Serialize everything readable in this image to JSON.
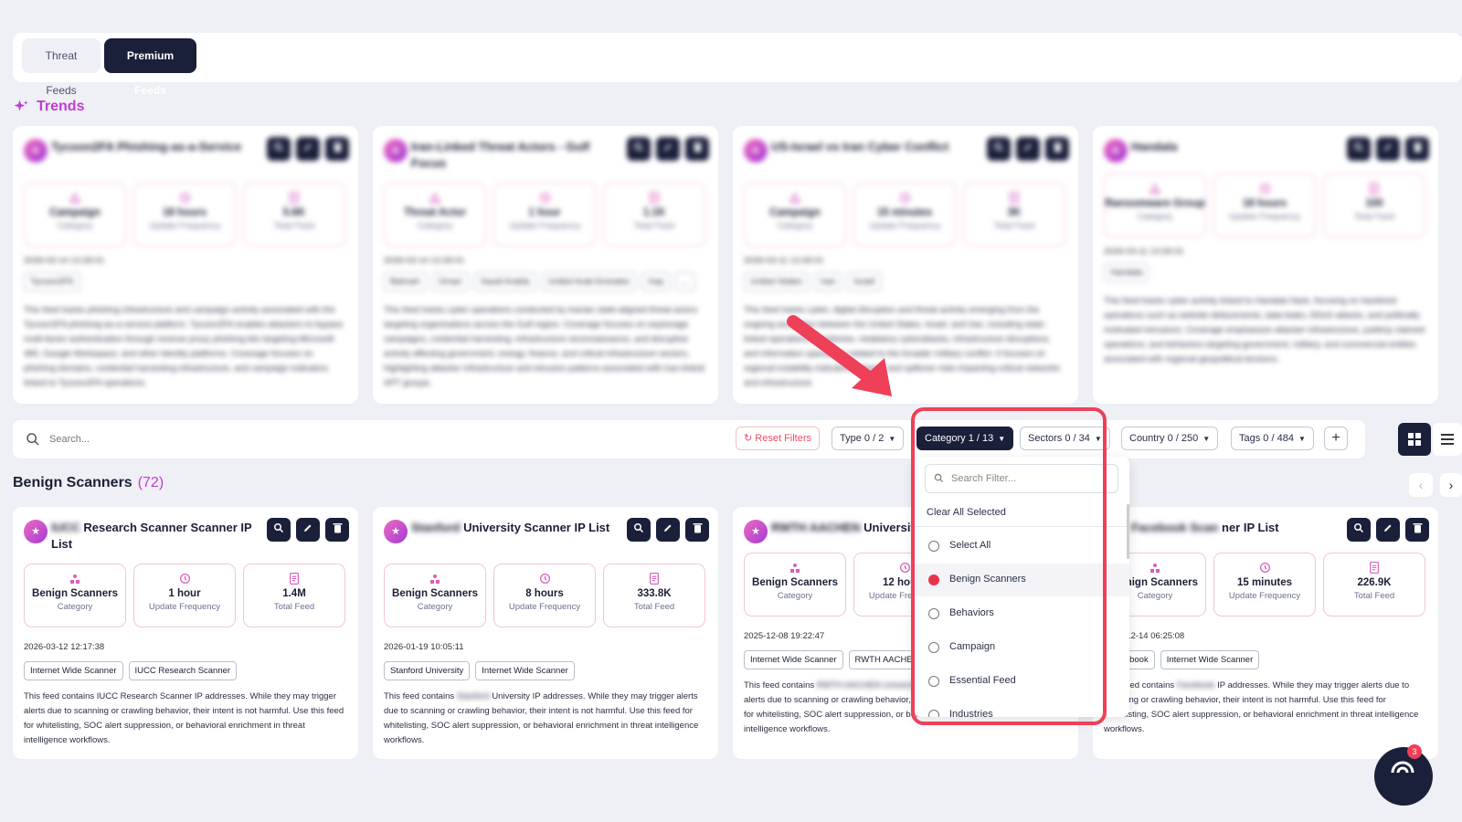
{
  "tabs": [
    {
      "label": "Threat Feeds"
    },
    {
      "label": "Premium Feeds"
    }
  ],
  "trends": {
    "title": "Trends"
  },
  "trend_cards": [
    {
      "title": "Tycoon2FA Phishing-as-a-Service",
      "stats": [
        {
          "v": "Campaign",
          "l": "Category"
        },
        {
          "v": "18 hours",
          "l": "Update Frequency"
        },
        {
          "v": "5.6K",
          "l": "Total Feed"
        }
      ],
      "date": "2026-03-14 13:26:01",
      "tags": [
        "Tycoon2FA"
      ],
      "desc": "This feed tracks phishing infrastructure and campaign activity associated with the Tycoon2FA phishing-as-a-service platform. Tycoon2FA enables attackers to bypass multi-factor authentication through reverse proxy phishing kits targeting Microsoft 365, Google Workspace, and other identity platforms. Coverage focuses on phishing domains, credential harvesting infrastructure, and campaign indicators linked to Tycoon2FA operations."
    },
    {
      "title": "Iran-Linked Threat Actors - Gulf Focus",
      "stats": [
        {
          "v": "Threat Actor",
          "l": "Category"
        },
        {
          "v": "1 hour",
          "l": "Update Frequency"
        },
        {
          "v": "1.1K",
          "l": "Total Feed"
        }
      ],
      "date": "2026-03-14 13:26:01",
      "tags": [
        "Bahrain",
        "Oman",
        "Saudi Arabia",
        "United Arab Emirates",
        "Iraq",
        "..."
      ],
      "desc": "This feed tracks cyber operations conducted by Iranian state-aligned threat actors targeting organizations across the Gulf region. Coverage focuses on espionage campaigns, credential harvesting, infrastructure reconnaissance, and disruptive activity affecting government, energy, finance, and critical infrastructure sectors, highlighting attacker infrastructure and intrusion patterns associated with Iran-linked APT groups."
    },
    {
      "title": "US-Israel vs Iran Cyber Conflict",
      "stats": [
        {
          "v": "Campaign",
          "l": "Category"
        },
        {
          "v": "15 minutes",
          "l": "Update Frequency"
        },
        {
          "v": "3K",
          "l": "Total Feed"
        }
      ],
      "date": "2026-03-11 13:26:01",
      "tags": [
        "United States",
        "Iran",
        "Israel"
      ],
      "desc": "This feed tracks cyber, digital disruption and threat activity emerging from the ongoing escalation between the United States, Israel, and Iran, including state-linked operations, hacktivists, retaliatory cyberattacks, infrastructure disruptions, and information operations related to the broader military conflict. It focuses on regional instability indicators, attacks and spillover risks impacting critical networks and infrastructure."
    },
    {
      "title": "Handala",
      "stats": [
        {
          "v": "Ransomware Group",
          "l": "Category"
        },
        {
          "v": "18 hours",
          "l": "Update Frequency"
        },
        {
          "v": "100",
          "l": "Total Feed"
        }
      ],
      "date": "2026-03-11 13:26:01",
      "tags": [
        "Handala"
      ],
      "desc": "This feed tracks cyber activity linked to Handala Hack, focusing on hacktivist operations such as website defacements, data leaks, DDoS attacks, and politically motivated intrusions. Coverage emphasizes attacker infrastructure, publicly claimed operations, and behaviors targeting government, military, and commercial entities associated with regional geopolitical tensions."
    }
  ],
  "search": {
    "placeholder": "Search..."
  },
  "filters": {
    "reset": "Reset Filters",
    "type": "Type 0 / 2",
    "category": "Category 1 / 13",
    "sectors": "Sectors 0 / 34",
    "country": "Country 0 / 250",
    "tags": "Tags 0 / 484",
    "add": "+"
  },
  "dropdown": {
    "search_placeholder": "Search Filter...",
    "clear": "Clear All Selected",
    "options": [
      {
        "label": "Select All",
        "checked": false
      },
      {
        "label": "Benign Scanners",
        "checked": true
      },
      {
        "label": "Behaviors",
        "checked": false
      },
      {
        "label": "Campaign",
        "checked": false
      },
      {
        "label": "Essential Feed",
        "checked": false
      },
      {
        "label": "Industries",
        "checked": false
      }
    ]
  },
  "section": {
    "title": "Benign Scanners",
    "count": "(72)"
  },
  "feed_cards": [
    {
      "title_blur": "IUCC",
      "title": "Research Scanner Scanner IP List",
      "stats": [
        {
          "v": "Benign Scanners",
          "l": "Category"
        },
        {
          "v": "1 hour",
          "l": "Update Frequency"
        },
        {
          "v": "1.4M",
          "l": "Total Feed"
        }
      ],
      "date": "2026-03-12 12:17:38",
      "tags": [
        "Internet Wide Scanner",
        "IUCC Research Scanner"
      ],
      "desc_pre": "",
      "desc_blur": "",
      "desc": "This feed contains IUCC Research Scanner IP addresses. While they may trigger alerts due to scanning or crawling behavior, their intent is not harmful. Use this feed for whitelisting, SOC alert suppression, or behavioral enrichment in threat intelligence workflows."
    },
    {
      "title_blur": "Stanford",
      "title": "University Scanner IP List",
      "stats": [
        {
          "v": "Benign Scanners",
          "l": "Category"
        },
        {
          "v": "8 hours",
          "l": "Update Frequency"
        },
        {
          "v": "333.8K",
          "l": "Total Feed"
        }
      ],
      "date": "2026-01-19 10:05:11",
      "tags": [
        "Stanford University",
        "Internet Wide Scanner"
      ],
      "desc_pre": "This feed contains",
      "desc_blur": "Stanford",
      "desc": "University IP addresses. While they may trigger alerts due to scanning or crawling behavior, their intent is not harmful. Use this feed for whitelisting, SOC alert suppression, or behavioral enrichment in threat intelligence workflows."
    },
    {
      "title_blur": "RWTH AACHEN",
      "title": "University IP List",
      "stats": [
        {
          "v": "Benign Scanners",
          "l": "Category"
        },
        {
          "v": "12 hours",
          "l": "Update Frequency"
        },
        {
          "v": "",
          "l": ""
        }
      ],
      "date": "2025-12-08 19:22:47",
      "tags": [
        "Internet Wide Scanner",
        "RWTH AACHEN"
      ],
      "desc_pre": "This feed contains",
      "desc_blur": "RWTH AACHEN University",
      "desc": "addresses. While they may trigger alerts due to scanning or crawling behavior, their intent is not harmful. Use this feed for whitelisting, SOC alert suppression, or behavioral enrichment in threat intelligence workflows."
    },
    {
      "title_blur": "Facebook Scan",
      "title": "ner IP List",
      "stats": [
        {
          "v": "Benign Scanners",
          "l": "Category"
        },
        {
          "v": "15 minutes",
          "l": "Update Frequency"
        },
        {
          "v": "226.9K",
          "l": "Total Feed"
        }
      ],
      "date": "2025-12-14 06:25:08",
      "tags": [
        "Facebook",
        "Internet Wide Scanner"
      ],
      "desc_pre": "This feed contains",
      "desc_blur": "Facebook",
      "desc": "IP addresses. While they may trigger alerts due to scanning or crawling behavior, their intent is not harmful. Use this feed for whitelisting, SOC alert suppression, or behavioral enrichment in threat intelligence workflows."
    }
  ],
  "chat": {
    "badge": "3"
  },
  "colors": {
    "accent": "#c23bd4",
    "dark": "#1a1f3a",
    "danger": "#ee4059"
  }
}
